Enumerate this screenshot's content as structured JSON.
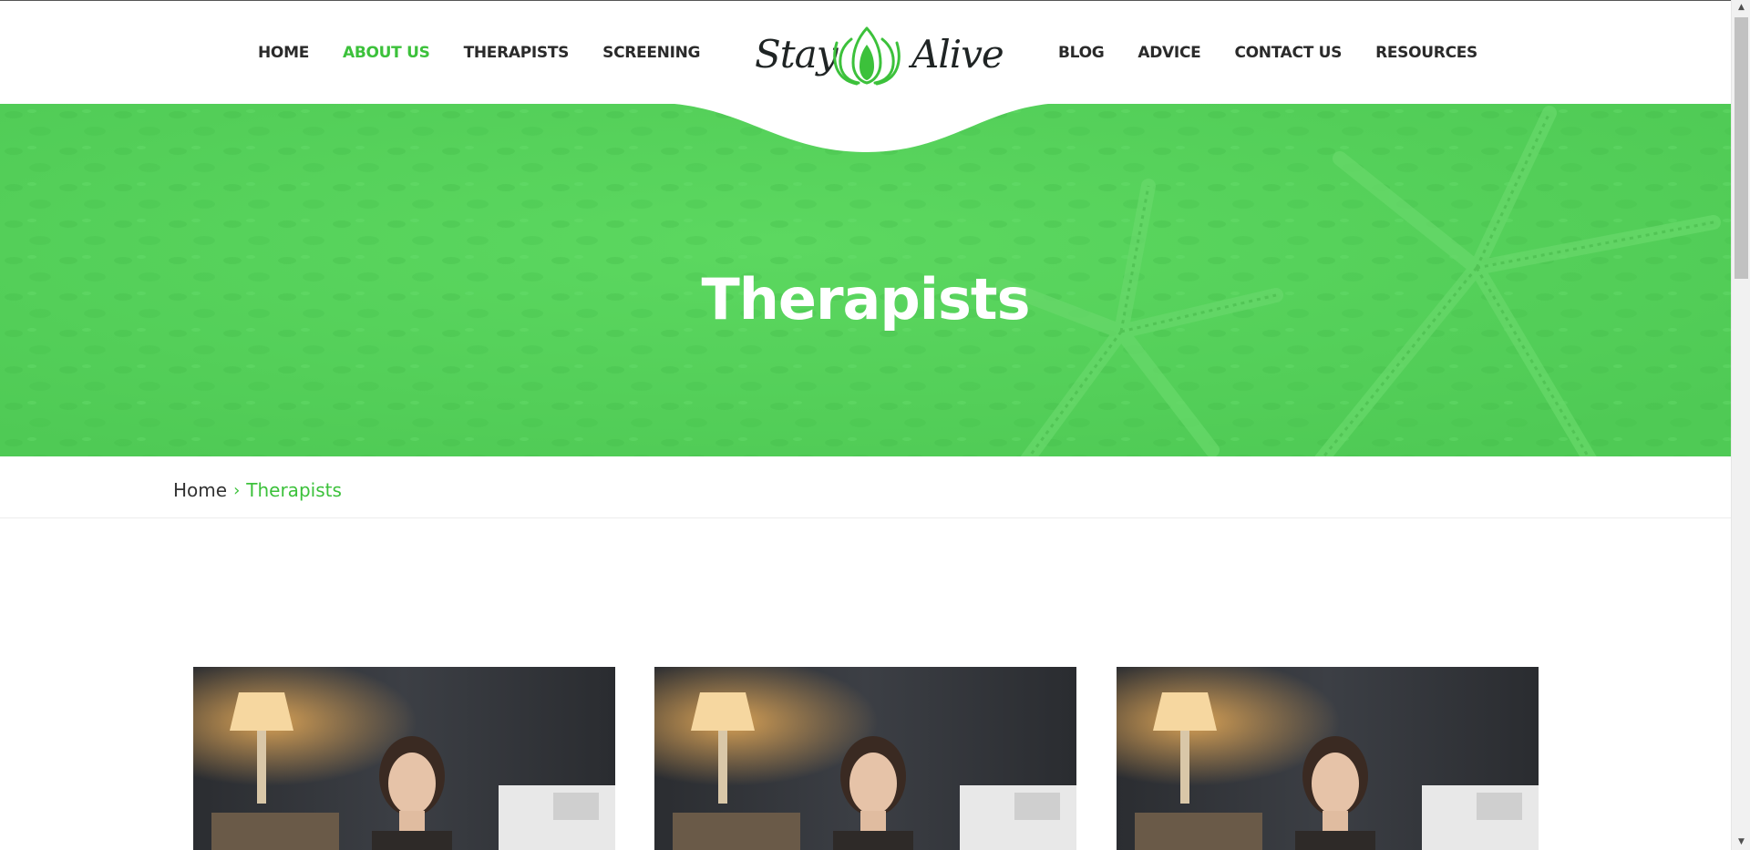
{
  "nav": {
    "left_items": [
      {
        "label": "HOME",
        "active": false
      },
      {
        "label": "ABOUT US",
        "active": true
      },
      {
        "label": "THERAPISTS",
        "active": false
      },
      {
        "label": "SCREENING",
        "active": false
      }
    ],
    "right_items": [
      {
        "label": "BLOG",
        "active": false
      },
      {
        "label": "ADVICE",
        "active": false
      },
      {
        "label": "CONTACT US",
        "active": false
      },
      {
        "label": "RESOURCES",
        "active": false
      }
    ]
  },
  "logo": {
    "word_left": "Stay",
    "word_right": "Alive",
    "icon": "lotus-icon"
  },
  "hero": {
    "title": "Therapists"
  },
  "breadcrumb": {
    "home": "Home",
    "separator_icon": "chevron-right-icon",
    "current": "Therapists"
  },
  "therapists": [
    {
      "photo": "therapist-photo"
    },
    {
      "photo": "therapist-photo"
    },
    {
      "photo": "therapist-photo"
    }
  ],
  "colors": {
    "accent": "#3cc13b",
    "hero_overlay": "#52cd58",
    "text_dark": "#2a2a2a",
    "white": "#ffffff"
  }
}
